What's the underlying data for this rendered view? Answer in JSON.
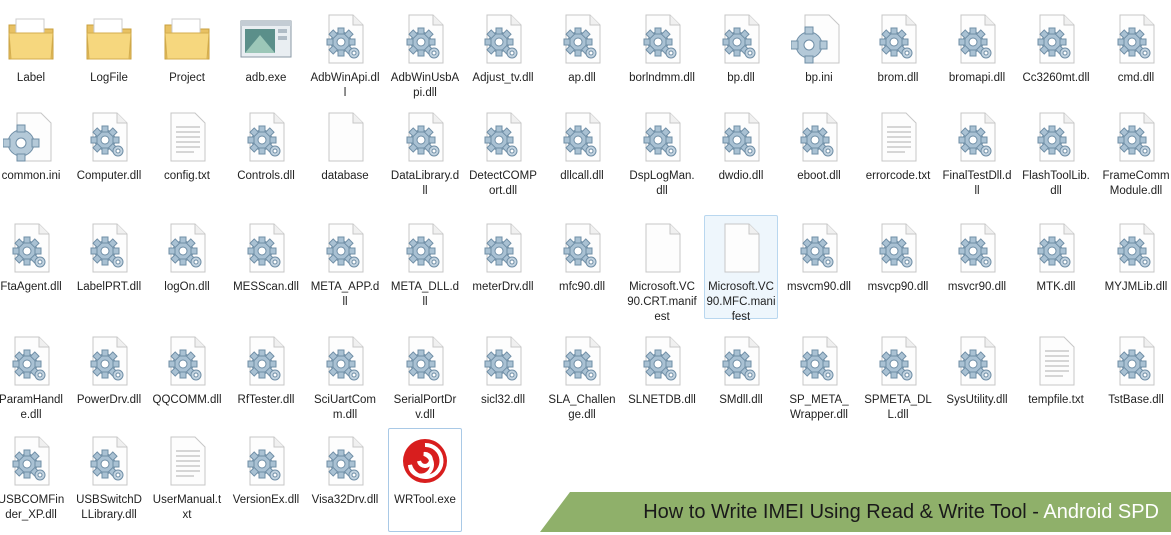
{
  "explorer": {
    "files": [
      {
        "name": "Label",
        "icon": "folder-icon"
      },
      {
        "name": "LogFile",
        "icon": "folder-icon"
      },
      {
        "name": "Project",
        "icon": "folder-icon"
      },
      {
        "name": "adb.exe",
        "icon": "app-window-icon"
      },
      {
        "name": "AdbWinApi.dll",
        "icon": "dll-gear-icon"
      },
      {
        "name": "AdbWinUsbApi.dll",
        "icon": "dll-gear-icon"
      },
      {
        "name": "Adjust_tv.dll",
        "icon": "dll-gear-icon"
      },
      {
        "name": "ap.dll",
        "icon": "dll-gear-icon"
      },
      {
        "name": "borlndmm.dll",
        "icon": "dll-gear-icon"
      },
      {
        "name": "bp.dll",
        "icon": "dll-gear-icon"
      },
      {
        "name": "bp.ini",
        "icon": "ini-gear-icon"
      },
      {
        "name": "brom.dll",
        "icon": "dll-gear-icon"
      },
      {
        "name": "bromapi.dll",
        "icon": "dll-gear-icon"
      },
      {
        "name": "Cc3260mt.dll",
        "icon": "dll-gear-icon"
      },
      {
        "name": "cmd.dll",
        "icon": "dll-gear-icon"
      },
      {
        "name": "common.ini",
        "icon": "ini-gear-icon"
      },
      {
        "name": "Computer.dll",
        "icon": "dll-gear-icon"
      },
      {
        "name": "config.txt",
        "icon": "text-file-icon"
      },
      {
        "name": "Controls.dll",
        "icon": "dll-gear-icon"
      },
      {
        "name": "database",
        "icon": "blank-file-icon"
      },
      {
        "name": "DataLibrary.dll",
        "icon": "dll-gear-icon"
      },
      {
        "name": "DetectCOMPort.dll",
        "icon": "dll-gear-icon"
      },
      {
        "name": "dllcall.dll",
        "icon": "dll-gear-icon"
      },
      {
        "name": "DspLogMan.dll",
        "icon": "dll-gear-icon"
      },
      {
        "name": "dwdio.dll",
        "icon": "dll-gear-icon"
      },
      {
        "name": "eboot.dll",
        "icon": "dll-gear-icon"
      },
      {
        "name": "errorcode.txt",
        "icon": "text-file-icon"
      },
      {
        "name": "FinalTestDll.dll",
        "icon": "dll-gear-icon"
      },
      {
        "name": "FlashToolLib.dll",
        "icon": "dll-gear-icon"
      },
      {
        "name": "FrameCommModule.dll",
        "icon": "dll-gear-icon"
      },
      {
        "name": "FtaAgent.dll",
        "icon": "dll-gear-icon"
      },
      {
        "name": "LabelPRT.dll",
        "icon": "dll-gear-icon"
      },
      {
        "name": "logOn.dll",
        "icon": "dll-gear-icon"
      },
      {
        "name": "MESScan.dll",
        "icon": "dll-gear-icon"
      },
      {
        "name": "META_APP.dll",
        "icon": "dll-gear-icon"
      },
      {
        "name": "META_DLL.dll",
        "icon": "dll-gear-icon"
      },
      {
        "name": "meterDrv.dll",
        "icon": "dll-gear-icon"
      },
      {
        "name": "mfc90.dll",
        "icon": "dll-gear-icon"
      },
      {
        "name": "Microsoft.VC90.CRT.manifest",
        "icon": "blank-file-icon"
      },
      {
        "name": "Microsoft.VC90.MFC.manifest",
        "icon": "blank-file-icon"
      },
      {
        "name": "msvcm90.dll",
        "icon": "dll-gear-icon"
      },
      {
        "name": "msvcp90.dll",
        "icon": "dll-gear-icon"
      },
      {
        "name": "msvcr90.dll",
        "icon": "dll-gear-icon"
      },
      {
        "name": "MTK.dll",
        "icon": "dll-gear-icon"
      },
      {
        "name": "MYJMLib.dll",
        "icon": "dll-gear-icon"
      },
      {
        "name": "ParamHandle.dll",
        "icon": "dll-gear-icon"
      },
      {
        "name": "PowerDrv.dll",
        "icon": "dll-gear-icon"
      },
      {
        "name": "QQCOMM.dll",
        "icon": "dll-gear-icon"
      },
      {
        "name": "RfTester.dll",
        "icon": "dll-gear-icon"
      },
      {
        "name": "SciUartComm.dll",
        "icon": "dll-gear-icon"
      },
      {
        "name": "SerialPortDrv.dll",
        "icon": "dll-gear-icon"
      },
      {
        "name": "sicl32.dll",
        "icon": "dll-gear-icon"
      },
      {
        "name": "SLA_Challenge.dll",
        "icon": "dll-gear-icon"
      },
      {
        "name": "SLNETDB.dll",
        "icon": "dll-gear-icon"
      },
      {
        "name": "SMdll.dll",
        "icon": "dll-gear-icon"
      },
      {
        "name": "SP_META_Wrapper.dll",
        "icon": "dll-gear-icon"
      },
      {
        "name": "SPMETA_DLL.dll",
        "icon": "dll-gear-icon"
      },
      {
        "name": "SysUtility.dll",
        "icon": "dll-gear-icon"
      },
      {
        "name": "tempfile.txt",
        "icon": "text-file-icon"
      },
      {
        "name": "TstBase.dll",
        "icon": "dll-gear-icon"
      },
      {
        "name": "USBCOMFinder_XP.dll",
        "icon": "dll-gear-icon"
      },
      {
        "name": "USBSwitchDLLibrary.dll",
        "icon": "dll-gear-icon"
      },
      {
        "name": "UserManual.txt",
        "icon": "text-file-icon"
      },
      {
        "name": "VersionEx.dll",
        "icon": "dll-gear-icon"
      },
      {
        "name": "Visa32Drv.dll",
        "icon": "dll-gear-icon"
      },
      {
        "name": "WRTool.exe",
        "icon": "wrtool-swirl-icon"
      }
    ],
    "selected_item": "Microsoft.VC90.MFC.manifest",
    "focused_item": "WRTool.exe"
  },
  "banner": {
    "text_main": "How to Write IMEI Using Read & Write Tool - ",
    "text_accent": "Android SPD",
    "bg_color": "#8fb06a"
  }
}
